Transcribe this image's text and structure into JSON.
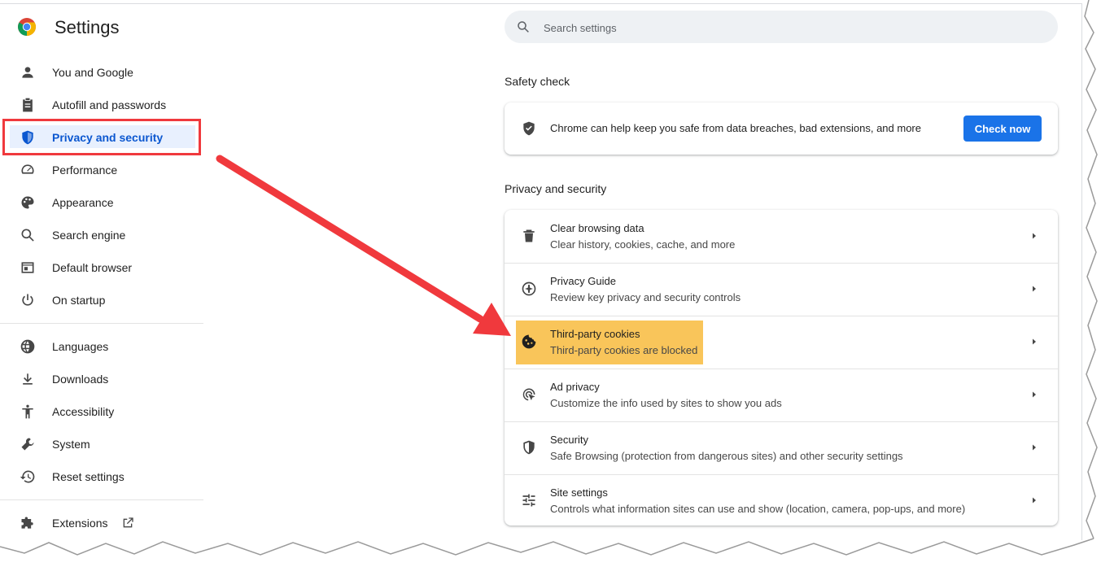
{
  "app": {
    "title": "Settings"
  },
  "nav": {
    "items": [
      {
        "label": "You and Google",
        "icon": "person-icon"
      },
      {
        "label": "Autofill and passwords",
        "icon": "clipboard-icon"
      },
      {
        "label": "Privacy and security",
        "icon": "shield-icon",
        "active": true
      },
      {
        "label": "Performance",
        "icon": "speedometer-icon"
      },
      {
        "label": "Appearance",
        "icon": "palette-icon"
      },
      {
        "label": "Search engine",
        "icon": "search-icon"
      },
      {
        "label": "Default browser",
        "icon": "browser-icon"
      },
      {
        "label": "On startup",
        "icon": "power-icon"
      },
      {
        "label": "Languages",
        "icon": "globe-icon"
      },
      {
        "label": "Downloads",
        "icon": "download-icon"
      },
      {
        "label": "Accessibility",
        "icon": "accessibility-icon"
      },
      {
        "label": "System",
        "icon": "wrench-icon"
      },
      {
        "label": "Reset settings",
        "icon": "history-icon"
      },
      {
        "label": "Extensions",
        "icon": "puzzle-icon"
      }
    ]
  },
  "search": {
    "placeholder": "Search settings"
  },
  "safety_check": {
    "title": "Safety check",
    "text": "Chrome can help keep you safe from data breaches, bad extensions, and more",
    "button": "Check now"
  },
  "privacy": {
    "title": "Privacy and security",
    "rows": [
      {
        "title": "Clear browsing data",
        "subtitle": "Clear history, cookies, cache, and more",
        "icon": "trash-icon"
      },
      {
        "title": "Privacy Guide",
        "subtitle": "Review key privacy and security controls",
        "icon": "compass-icon"
      },
      {
        "title": "Third-party cookies",
        "subtitle": "Third-party cookies are blocked",
        "icon": "cookie-icon",
        "highlighted": true
      },
      {
        "title": "Ad privacy",
        "subtitle": "Customize the info used by sites to show you ads",
        "icon": "ad-privacy-icon"
      },
      {
        "title": "Security",
        "subtitle": "Safe Browsing (protection from dangerous sites) and other security settings",
        "icon": "security-shield-icon"
      },
      {
        "title": "Site settings",
        "subtitle": "Controls what information sites can use and show (location, camera, pop-ups, and more)",
        "icon": "sliders-icon"
      }
    ]
  },
  "colors": {
    "accent": "#0b57d0",
    "button": "#1a73e8",
    "highlight": "#f9c55a",
    "annotation_red": "#f0393d"
  }
}
